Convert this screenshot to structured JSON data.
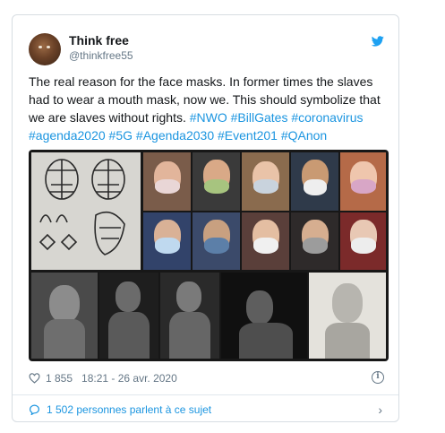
{
  "tweet": {
    "display_name": "Think free",
    "handle": "@thinkfree55",
    "body_text": "The real reason for the face masks.  In former times the slaves had to wear a mouth mask, now we.  This should symbolize that we are slaves without rights.",
    "hashtags": [
      "#NWO",
      "#BillGates",
      "#coronavirus",
      "#agenda2020",
      "#5G",
      "#Agenda2030",
      "#Event201",
      "#QAnon"
    ],
    "likes": "1 855",
    "timestamp": "18:21 - 26 avr. 2020",
    "conversation": "1 502 personnes parlent à ce sujet"
  },
  "icons": {
    "brand": "twitter-bird-icon",
    "like": "heart-icon",
    "info": "info-icon",
    "comment": "comment-bubble-icon",
    "chevron": "chevron-right-icon"
  },
  "colors": {
    "link": "#1b95e0",
    "muted": "#657786",
    "twitter_blue": "#1da1f2"
  }
}
